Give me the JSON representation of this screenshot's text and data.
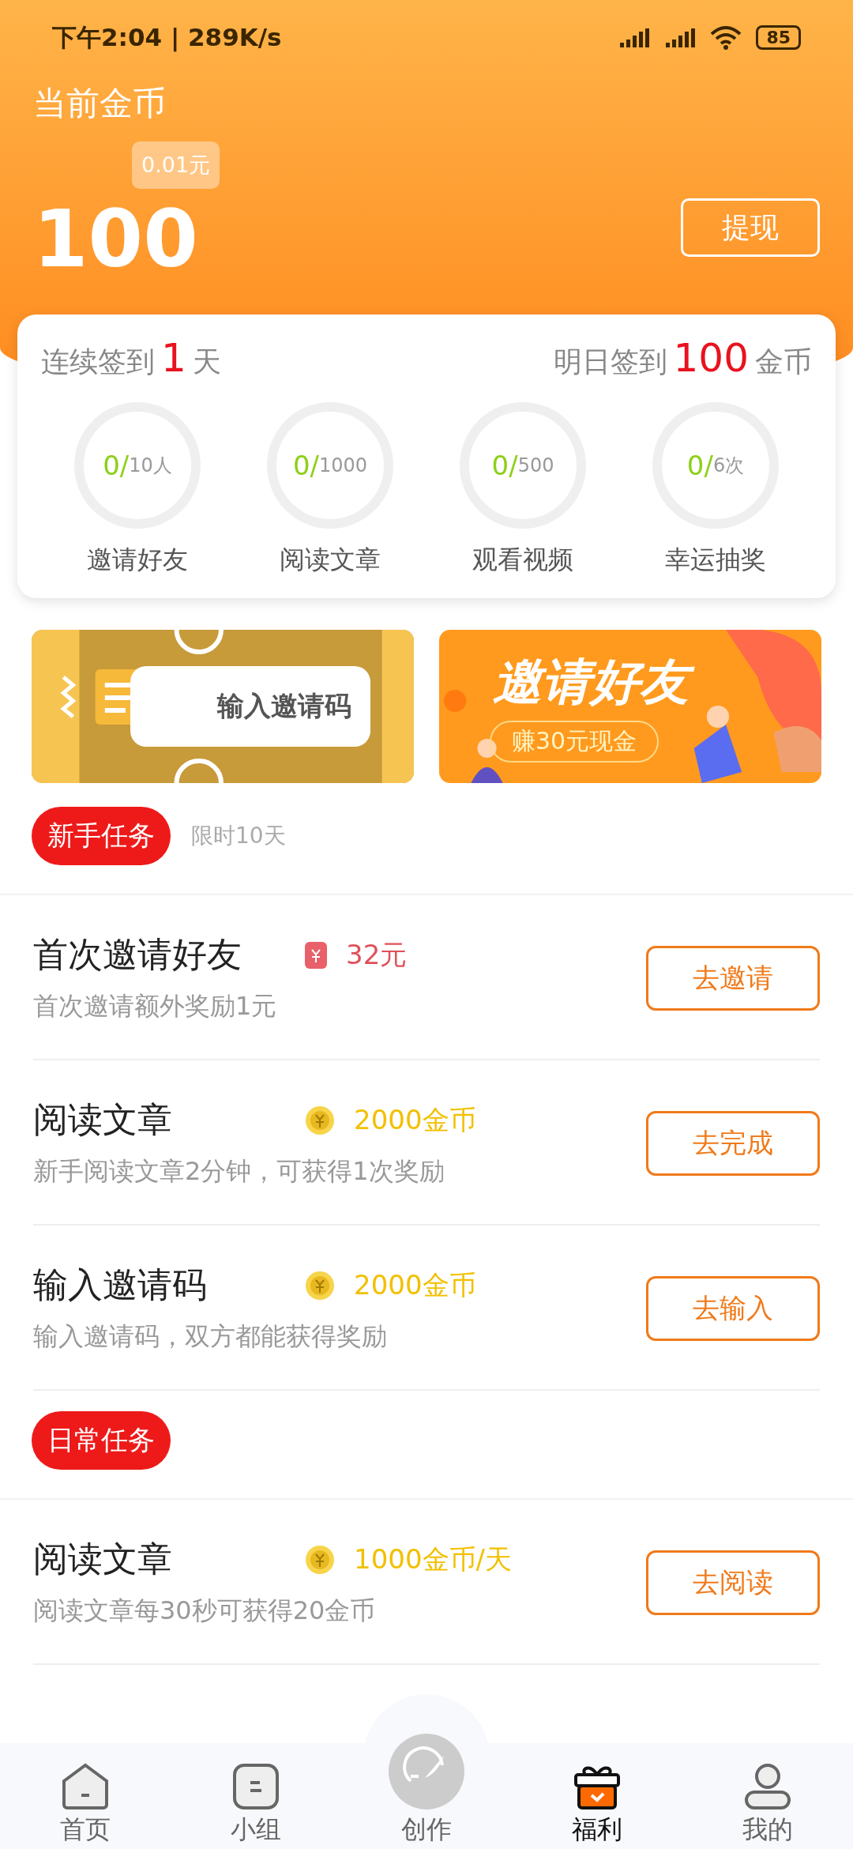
{
  "status_bar": {
    "time": "下午2:04 | 289K/s",
    "battery": "85"
  },
  "header": {
    "label": "当前金币",
    "coins": "100",
    "cash_tip": "0.01元",
    "withdraw_button": "提现"
  },
  "sign_in": {
    "streak_prefix": "连续签到",
    "streak_days": "1",
    "streak_suffix": "天",
    "tomorrow_prefix": "明日签到",
    "tomorrow_coins": "100",
    "tomorrow_suffix": "金币"
  },
  "progress": [
    {
      "done": "0/",
      "total": "10人",
      "label": "邀请好友"
    },
    {
      "done": "0/",
      "total": "1000",
      "label": "阅读文章"
    },
    {
      "done": "0/",
      "total": "500",
      "label": "观看视频"
    },
    {
      "done": "0/",
      "total": "6次",
      "label": "幸运抽奖"
    }
  ],
  "banners": [
    {
      "kind": "code",
      "title": "输入邀请码"
    },
    {
      "kind": "invite",
      "title": "邀请好友",
      "subtitle": "赚30元现金"
    }
  ],
  "sections": [
    {
      "title": "新手任务",
      "note": "限时10天",
      "tasks": [
        {
          "title": "首次邀请好友",
          "kind": "cash",
          "reward": "32元",
          "desc": "首次邀请额外奖励1元",
          "action": "去邀请"
        },
        {
          "title": "阅读文章",
          "kind": "coin",
          "reward": "2000金币",
          "desc": "新手阅读文章2分钟，可获得1次奖励",
          "action": "去完成"
        },
        {
          "title": "输入邀请码",
          "kind": "coin",
          "reward": "2000金币",
          "desc": "输入邀请码，双方都能获得奖励",
          "action": "去输入"
        }
      ]
    },
    {
      "title": "日常任务",
      "tasks": [
        {
          "title": "阅读文章",
          "kind": "coin",
          "reward": "1000金币/天",
          "desc": "阅读文章每30秒可获得20金币",
          "action": "去阅读"
        }
      ]
    }
  ],
  "nav": [
    {
      "kind": "home",
      "label": "首页",
      "selected": false
    },
    {
      "kind": "group",
      "label": "小组",
      "selected": false
    },
    {
      "kind": "create",
      "label": "创作",
      "selected": false
    },
    {
      "kind": "gift",
      "label": "福利",
      "selected": true
    },
    {
      "kind": "me",
      "label": "我的",
      "selected": false
    }
  ]
}
